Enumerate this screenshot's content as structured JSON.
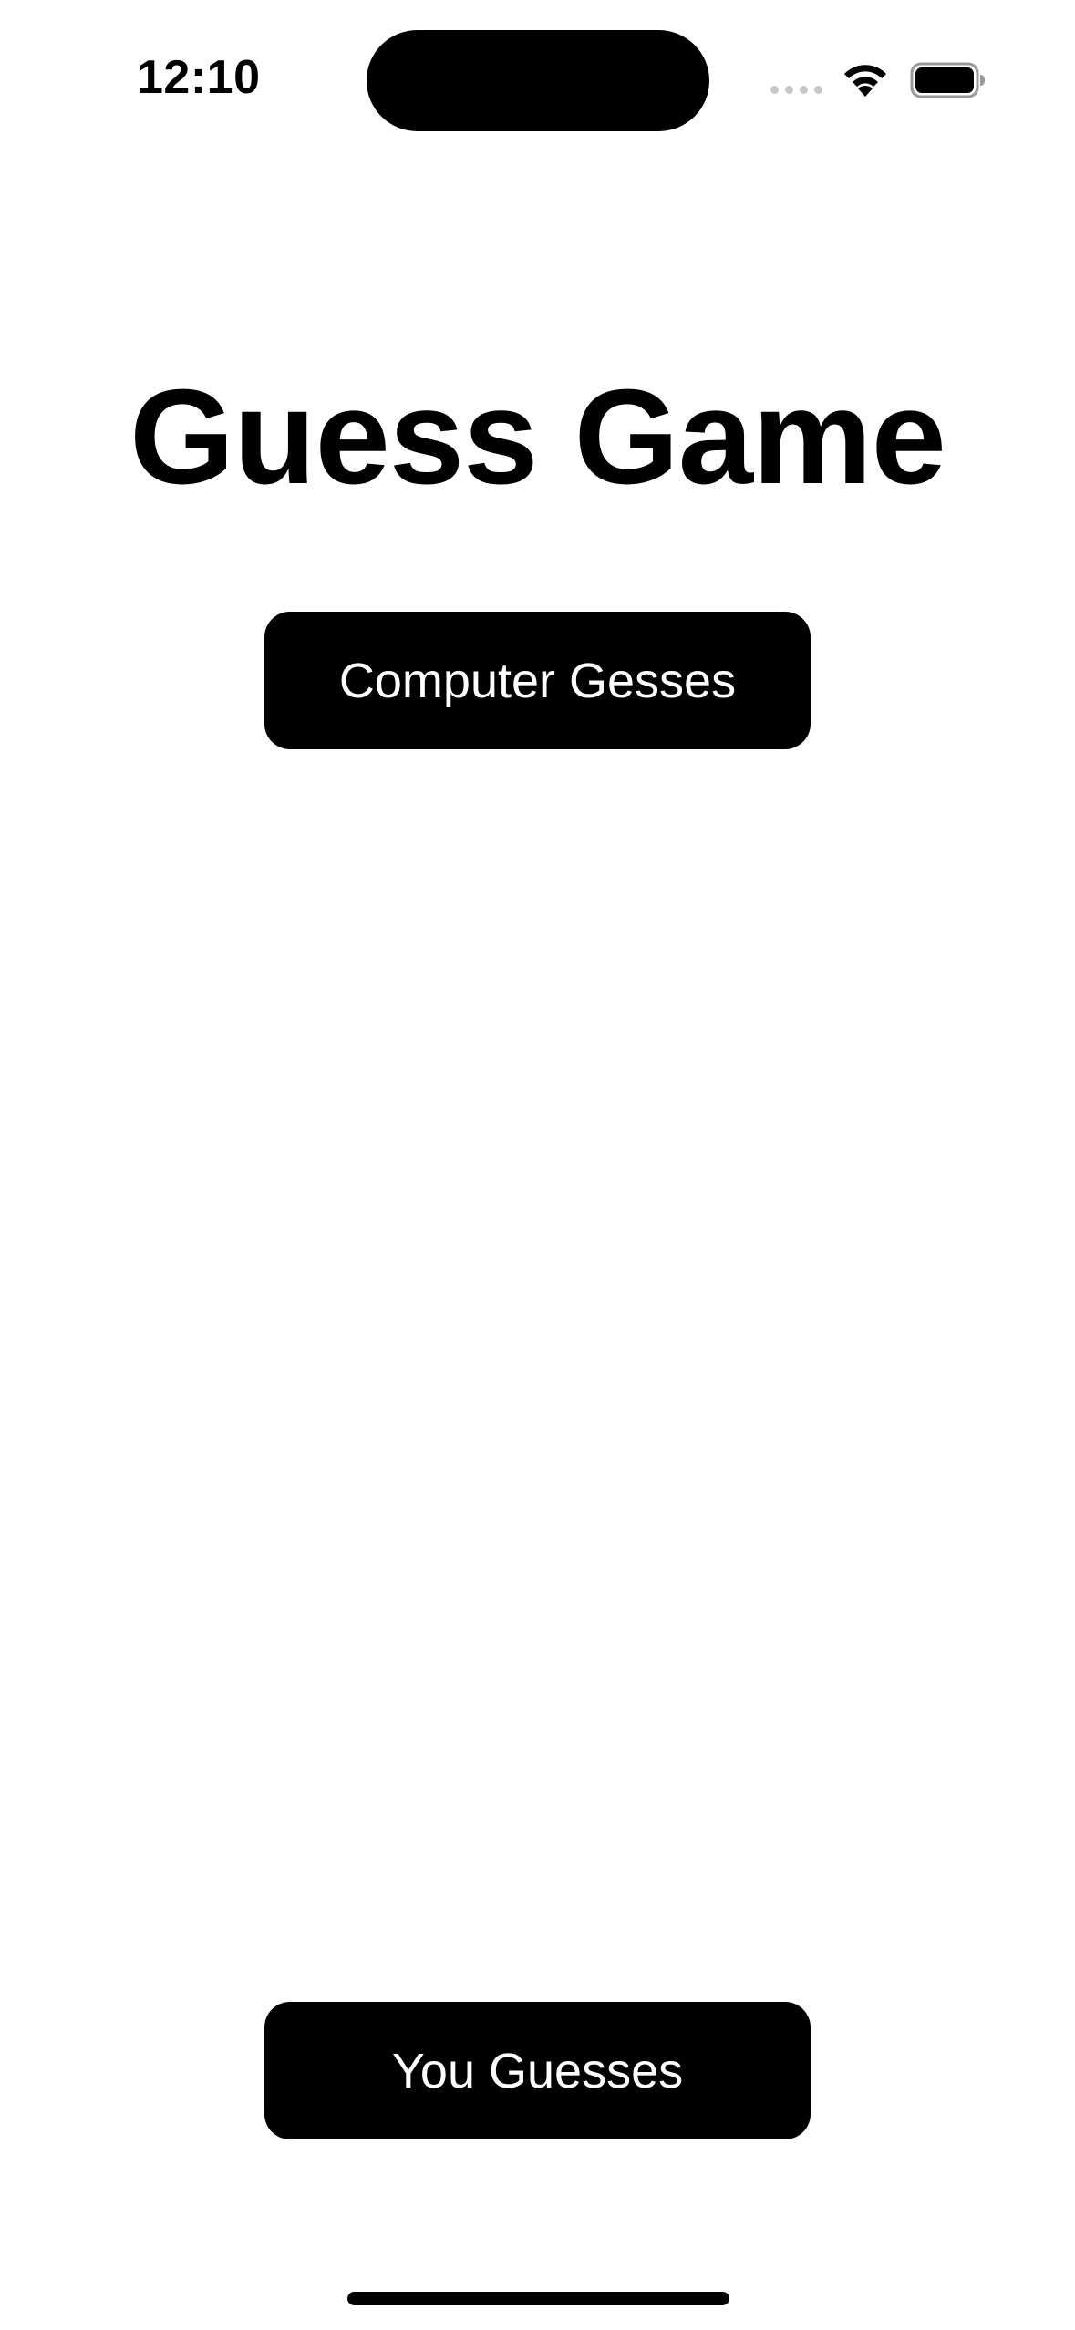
{
  "status_bar": {
    "time": "12:10",
    "icons": [
      "cellular-signal-icon",
      "wifi-icon",
      "battery-icon"
    ]
  },
  "main": {
    "title": "Guess Game",
    "computer_button_label": "Computer Gesses",
    "you_button_label": "You Guesses"
  },
  "colors": {
    "background": "#ffffff",
    "button": "#000000",
    "button_text": "#ffffff",
    "title": "#000000"
  }
}
